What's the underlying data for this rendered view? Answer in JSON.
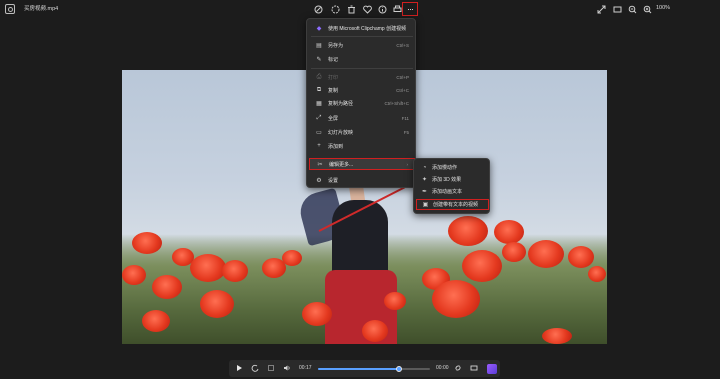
{
  "titlebar": {
    "filename": "买房视频.mp4",
    "zoom": "100%",
    "more_label": "···"
  },
  "toolbar_icons": [
    "edit-icon",
    "erase-icon",
    "delete-icon",
    "favorite-icon",
    "info-icon",
    "print-icon",
    "more-icon"
  ],
  "right_icons": [
    "expand-icon",
    "window-icon",
    "zoom-out-icon",
    "zoom-in-icon"
  ],
  "menu": {
    "items": [
      {
        "icon": "◆",
        "label": "使用 Microsoft Clipchamp 创建视频",
        "shortcut": ""
      },
      {
        "icon": "▤",
        "label": "另存为",
        "shortcut": "Ctrl+S"
      },
      {
        "icon": "✎",
        "label": "标记",
        "shortcut": ""
      },
      {
        "icon": "⎙",
        "label": "打印",
        "shortcut": "Ctrl+P"
      },
      {
        "icon": "⧉",
        "label": "复制",
        "shortcut": "Ctrl+C"
      },
      {
        "icon": "▦",
        "label": "复制为路径",
        "shortcut": "Ctrl+Shift+C"
      },
      {
        "icon": "⤢",
        "label": "全屏",
        "shortcut": "F11"
      },
      {
        "icon": "▭",
        "label": "幻灯片放映",
        "shortcut": "F5"
      },
      {
        "icon": "+",
        "label": "添加到",
        "shortcut": ""
      },
      {
        "icon": "✂",
        "label": "编辑更多...",
        "shortcut": "›"
      },
      {
        "icon": "⚙",
        "label": "设置",
        "shortcut": ""
      }
    ]
  },
  "submenu": {
    "items": [
      {
        "icon": "◔",
        "label": "添加慢动作"
      },
      {
        "icon": "✦",
        "label": "添加 3D 效果"
      },
      {
        "icon": "✒",
        "label": "添加动画文本"
      },
      {
        "icon": "▣",
        "label": "创建带有文本的视频"
      }
    ]
  },
  "player": {
    "current_time": "00:17",
    "total_time": "00:00",
    "progress": 0.72
  }
}
